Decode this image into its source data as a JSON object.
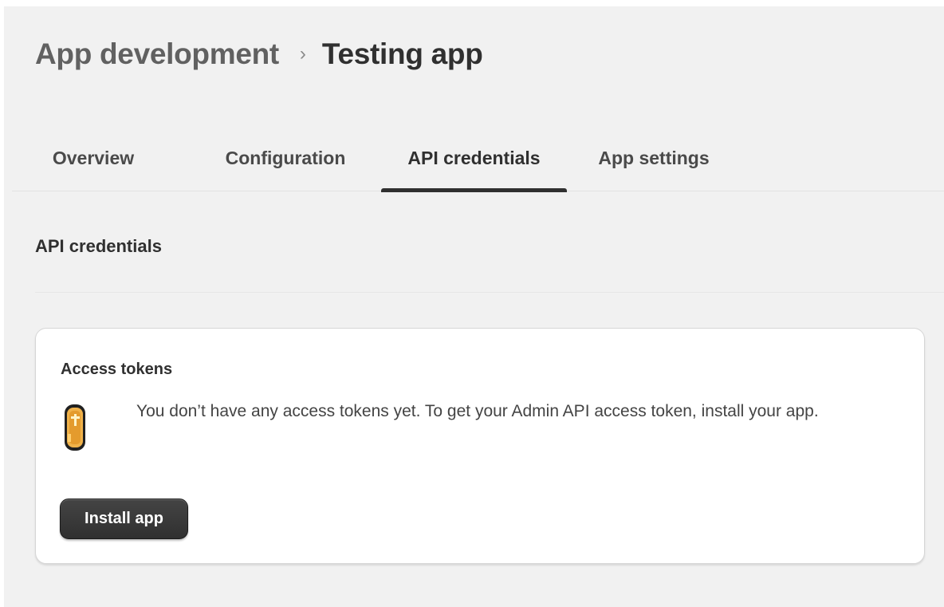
{
  "breadcrumb": {
    "parent": "App development",
    "separator": "›",
    "current": "Testing app"
  },
  "tabs": [
    {
      "label": "Overview",
      "active": false
    },
    {
      "label": "Configuration",
      "active": false
    },
    {
      "label": "API credentials",
      "active": true
    },
    {
      "label": "App settings",
      "active": false
    }
  ],
  "section": {
    "title": "API credentials"
  },
  "card": {
    "title": "Access tokens",
    "icon": "token-coin-icon",
    "message": "You don’t have any access tokens yet. To get your Admin API access token, install your app.",
    "button_label": "Install app"
  },
  "colors": {
    "page_background": "#f1f1f1",
    "card_background": "#ffffff",
    "primary_button": "#303030",
    "active_tab_underline": "#303030",
    "token_icon_fill": "#f0b24a"
  }
}
